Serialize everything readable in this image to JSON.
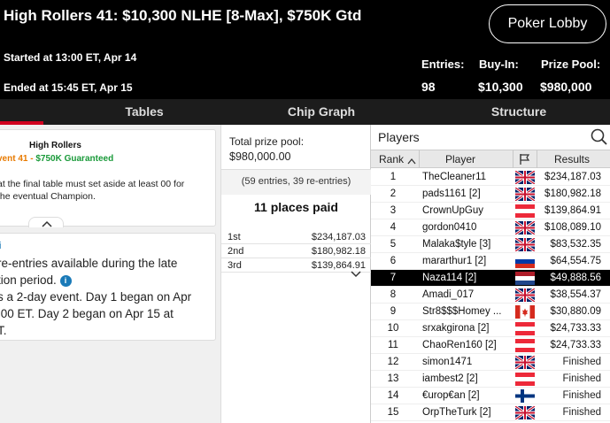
{
  "header": {
    "title": "High Rollers 41: $10,300 NLHE [8-Max], $750K Gtd",
    "started": "Started at 13:00 ET, Apr 14",
    "ended": "Ended at 15:45 ET, Apr 15",
    "lobby_button": "Poker Lobby",
    "stats": {
      "entries_label": "Entries:",
      "entries_value": "98",
      "buyin_label": "Buy-In:",
      "buyin_value": "$10,300",
      "prize_label": "Prize Pool:",
      "prize_value": "$980,000"
    }
  },
  "tabs": [
    "Tables",
    "Chip Graph",
    "Structure"
  ],
  "left_panel": {
    "card_title": "High Rollers",
    "card_event_part1": "vent 41 - ",
    "card_event_part2": "$750K Guaranteed",
    "card_text": "at the final table must set aside at least 00 for the eventual Champion.",
    "info_line1": "re-entries available during the late",
    "info_line2": "tion period.",
    "info_line3": "s a 2-day event. Day 1 began on Apr",
    "info_line4": ":00 ET. Day 2 began on Apr 15 at",
    "info_line5": "T."
  },
  "middle_panel": {
    "total_label": "Total prize pool:",
    "total_value": "$980,000.00",
    "entries_text": "(59 entries, 39 re-entries)",
    "places_paid": "11 places paid",
    "payouts": [
      {
        "place": "1st",
        "amount": "$234,187.03"
      },
      {
        "place": "2nd",
        "amount": "$180,982.18"
      },
      {
        "place": "3rd",
        "amount": "$139,864.91"
      }
    ]
  },
  "players": {
    "title": "Players",
    "columns": {
      "rank": "Rank",
      "player": "Player",
      "results": "Results"
    },
    "rows": [
      {
        "rank": "1",
        "name": "TheCleaner11",
        "flag": "uk",
        "result": "$234,187.03"
      },
      {
        "rank": "2",
        "name": "pads1161 [2]",
        "flag": "uk",
        "result": "$180,982.18"
      },
      {
        "rank": "3",
        "name": "CrownUpGuy",
        "flag": "austria",
        "result": "$139,864.91"
      },
      {
        "rank": "4",
        "name": "gordon0410",
        "flag": "uk",
        "result": "$108,089.10"
      },
      {
        "rank": "5",
        "name": "Malaka$tyle [3]",
        "flag": "uk",
        "result": "$83,532.35"
      },
      {
        "rank": "6",
        "name": "mararthur1 [2]",
        "flag": "russia",
        "result": "$64,554.75"
      },
      {
        "rank": "7",
        "name": "Naza114 [2]",
        "flag": "netherlands",
        "result": "$49,888.56"
      },
      {
        "rank": "8",
        "name": "Amadi_017",
        "flag": "uk",
        "result": "$38,554.37"
      },
      {
        "rank": "9",
        "name": "Str8$$$Homey ...",
        "flag": "canada",
        "result": "$30,880.09"
      },
      {
        "rank": "10",
        "name": "srxakgirona [2]",
        "flag": "austria",
        "result": "$24,733.33"
      },
      {
        "rank": "11",
        "name": "ChaoRen160 [2]",
        "flag": "austria",
        "result": "$24,733.33"
      },
      {
        "rank": "12",
        "name": "simon1471",
        "flag": "uk",
        "result": "Finished"
      },
      {
        "rank": "13",
        "name": "iambest2 [2]",
        "flag": "austria",
        "result": "Finished"
      },
      {
        "rank": "14",
        "name": "€urop€an [2]",
        "flag": "finland",
        "result": "Finished"
      },
      {
        "rank": "15",
        "name": "OrpTheTurk [2]",
        "flag": "uk",
        "result": "Finished"
      }
    ],
    "selected_rank": "7"
  },
  "colors": {
    "brand_red": "#d1001f",
    "event_orange": "#e87a00",
    "guarantee_green": "#1a9a3a"
  }
}
